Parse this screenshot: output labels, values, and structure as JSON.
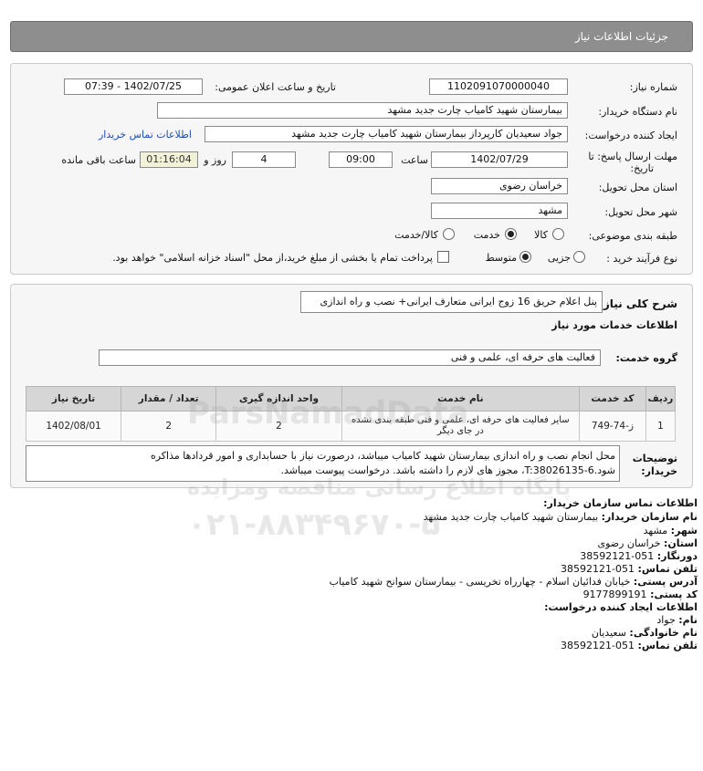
{
  "header": {
    "title": "جزئیات اطلاعات نیاز"
  },
  "form": {
    "need_number_label": "شماره نیاز:",
    "need_number": "1102091070000040",
    "announce_label": "تاریخ و ساعت اعلان عمومی:",
    "announce_value": "1402/07/25 - 07:39",
    "buyer_org_label": "نام دستگاه خریدار:",
    "buyer_org": "بیمارستان شهید کامیاب چارت جدید مشهد",
    "creator_label": "ایجاد کننده درخواست:",
    "creator": "جواد سعیدیان کارپرداز بیمارستان شهید کامیاب چارت جدید مشهد",
    "contact_link": "اطلاعات تماس خریدار",
    "deadline_label_1": "مهلت ارسال پاسخ: تا",
    "deadline_label_2": "تاریخ:",
    "deadline_date": "1402/07/29",
    "time_label": "ساعت",
    "deadline_time": "09:00",
    "days": "4",
    "days_label": "روز و",
    "remaining_time": "01:16:04",
    "remaining_label": "ساعت باقی مانده",
    "province_label": "استان محل تحویل:",
    "province": "خراسان رضوی",
    "city_label": "شهر محل تحویل:",
    "city": "مشهد",
    "category_label": "طبقه بندی موضوعی:",
    "category_options": [
      "کالا",
      "خدمت",
      "کالا/خدمت"
    ],
    "purchase_type_label": "نوع فرآیند خرید :",
    "purchase_options": [
      "جزیی",
      "متوسط"
    ],
    "treasury_note": "پرداخت تمام یا بخشی از مبلغ خرید،از محل \"اسناد خزانه اسلامی\" خواهد بود."
  },
  "needs": {
    "summary_label": "شرح کلی نیاز:",
    "summary": "پنل اعلام حریق 16 زوج ایرانی متعارف ایرانی+ نصب و راه اندازی",
    "services_heading": "اطلاعات خدمات مورد نیاز",
    "service_group_label": "گروه خدمت:",
    "service_group": "فعالیت های حرفه ای، علمی و فنی",
    "table": {
      "headers": [
        "ردیف",
        "کد خدمت",
        "نام خدمت",
        "واحد اندازه گیری",
        "تعداد / مقدار",
        "تاریخ نیاز"
      ],
      "rows": [
        [
          "1",
          "ز-74-749",
          "سایر فعالیت های حرفه ای، علمی و فنی طبقه بندی نشده در جای دیگر",
          "2",
          "2",
          "1402/08/01"
        ]
      ]
    },
    "buyer_notes_label_1": "توضیحات",
    "buyer_notes_label_2": "خریدار:",
    "buyer_notes_line1": "محل انجام نصب و راه اندازی بیمارستان شهید کامیاب میباشد، درصورت نیاز با حسابداری و امور قردادها مذاکره",
    "buyer_notes_line2": "شود.T:38026135-6، مجوز های لازم را داشته باشد. درخواست پیوست میباشد."
  },
  "contact": {
    "org_heading": "اطلاعات تماس سازمان خریدار:",
    "org_name_label": "نام سازمان خریدار:",
    "org_name": "بیمارستان شهید کامیاب چارت جدید مشهد",
    "city_label": "شهر:",
    "city": "مشهد",
    "province_label": "استان:",
    "province": "خراسان رضوی",
    "fax_label": "دورنگار:",
    "fax": "051-38592121",
    "phone_label": "تلفن تماس:",
    "phone": "051-38592121",
    "address_label": "آدرس پستی:",
    "address": "خیابان فدائیان اسلام - چهارراه تخریسی - بیمارستان سوانح شهید کامیاب",
    "postal_label": "کد پستی:",
    "postal": "9177899191",
    "creator_heading": "اطلاعات ایجاد کننده درخواست:",
    "first_name_label": "نام:",
    "first_name": "جواد",
    "last_name_label": "نام خانوادگی:",
    "last_name": "سعیدیان",
    "creator_phone_label": "تلفن تماس:",
    "creator_phone": "051-38592121"
  },
  "watermark": {
    "brand": "ParsNamadData",
    "caption": "پایگاه اطلاع رسانی مناقصه ومزایده",
    "phone": "۰۲۱-۸۸۳۴۹۶۷۰-۵"
  }
}
